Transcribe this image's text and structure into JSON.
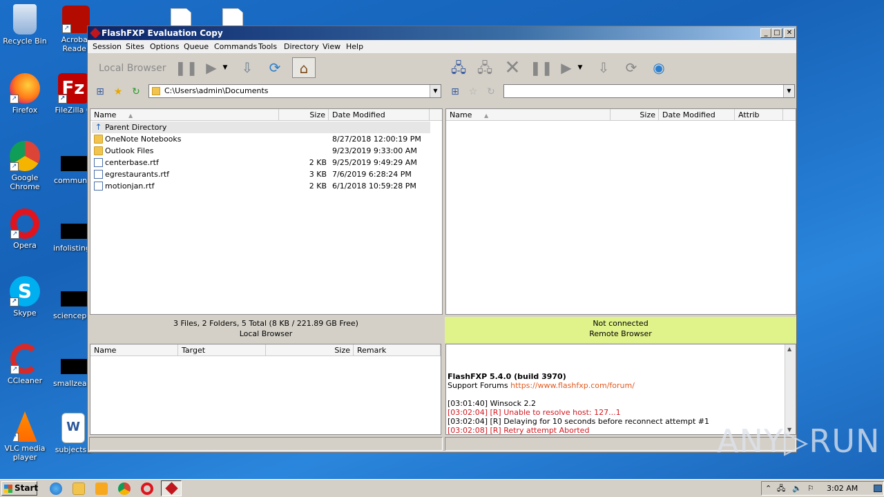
{
  "desktop": {
    "icons": [
      {
        "label": "Recycle Bin"
      },
      {
        "label": "Acrobat\nReader"
      },
      {
        "label": "Firefox"
      },
      {
        "label": "FileZilla C"
      },
      {
        "label": "Google\nChrome"
      },
      {
        "label": "communit"
      },
      {
        "label": "Opera"
      },
      {
        "label": "infolisting"
      },
      {
        "label": "Skype"
      },
      {
        "label": "sciencepo"
      },
      {
        "label": "CCleaner"
      },
      {
        "label": "smallzeale"
      },
      {
        "label": "VLC media\nplayer"
      },
      {
        "label": "subjectsb"
      }
    ]
  },
  "window": {
    "title": "FlashFXP Evaluation Copy",
    "menu": [
      "Session",
      "Sites",
      "Options",
      "Queue",
      "Commands",
      "Tools",
      "Directory",
      "View",
      "Help"
    ],
    "left": {
      "toolbar_label": "Local Browser",
      "path": "C:\\Users\\admin\\Documents",
      "columns": [
        "Name",
        "Size",
        "Date Modified"
      ],
      "rows": [
        {
          "name": "Parent Directory",
          "size": "",
          "date": "",
          "type": "up"
        },
        {
          "name": "OneNote Notebooks",
          "size": "",
          "date": "8/27/2018 12:00:19 PM",
          "type": "folder"
        },
        {
          "name": "Outlook Files",
          "size": "",
          "date": "9/23/2019 9:33:00 AM",
          "type": "folder"
        },
        {
          "name": "centerbase.rtf",
          "size": "2 KB",
          "date": "9/25/2019 9:49:29 AM",
          "type": "doc"
        },
        {
          "name": "egrestaurants.rtf",
          "size": "3 KB",
          "date": "7/6/2019 6:28:24 PM",
          "type": "doc"
        },
        {
          "name": "motionjan.rtf",
          "size": "2 KB",
          "date": "6/1/2018 10:59:28 PM",
          "type": "doc"
        }
      ],
      "status_line1": "3 Files, 2 Folders, 5 Total (8 KB / 221.89 GB Free)",
      "status_line2": "Local Browser"
    },
    "right": {
      "path": "",
      "columns": [
        "Name",
        "Size",
        "Date Modified",
        "Attrib"
      ],
      "status_line1": "Not connected",
      "status_line2": "Remote Browser"
    },
    "queue": {
      "columns": [
        "Name",
        "Target",
        "Size",
        "Remark"
      ]
    },
    "log": {
      "title": "FlashFXP 5.4.0 (build 3970)",
      "support_label": "Support Forums",
      "support_url": "https://www.flashfxp.com/forum/",
      "lines": [
        {
          "text": "[03:01:40] Winsock 2.2",
          "error": false
        },
        {
          "text": "[03:02:04] [R] Unable to resolve host: 127...1",
          "error": true
        },
        {
          "text": "[03:02:04] [R] Delaying for 10 seconds before reconnect attempt #1",
          "error": false
        },
        {
          "text": "[03:02:08] [R] Retry attempt Aborted",
          "error": true
        }
      ]
    }
  },
  "taskbar": {
    "start_label": "Start",
    "clock": "3:02 AM"
  },
  "watermark": "ANY▷RUN",
  "colors": {
    "desktop": "#1b6fc9",
    "titlebar": "#0a246a",
    "remote_status_bg": "#e0f28a",
    "error_text": "#d0161e",
    "link_text": "#e05a20"
  }
}
